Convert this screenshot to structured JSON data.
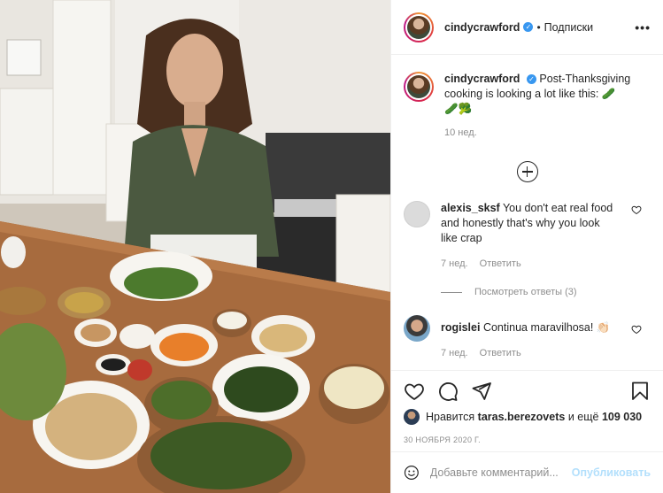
{
  "post": {
    "username": "cindycrawford",
    "follow_label": "Подписки",
    "more_label": "•••",
    "caption": "Post-Thanksgiving cooking is looking a lot like this: 🥒",
    "caption_emoji": "🥒🥦",
    "time_ago": "10 нед."
  },
  "comments": [
    {
      "username": "alexis_sksf",
      "text": "You don't eat real food and honestly that's why you look like crap",
      "time": "7 нед.",
      "reply_label": "Ответить",
      "view_replies": "Посмотреть ответы (3)"
    },
    {
      "username": "rogislei",
      "text": "Continua maravilhosa! 👏🏻",
      "time": "7 нед.",
      "reply_label": "Ответить"
    }
  ],
  "likes": {
    "prefix": "Нравится",
    "user": "taras.berezovets",
    "suffix": "и ещё",
    "count": "109 030"
  },
  "date": "30 НОЯБРЯ 2020 Г.",
  "add_comment": {
    "placeholder": "Добавьте комментарий...",
    "publish_label": "Опубликовать"
  },
  "colors": {
    "verified": "#3897f0",
    "publish": "#b2dffc",
    "meta": "#8e8e8e"
  },
  "icons": [
    "heart-icon",
    "comment-icon",
    "share-icon",
    "bookmark-icon",
    "emoji-icon",
    "plus-circle-icon",
    "verified-icon"
  ]
}
